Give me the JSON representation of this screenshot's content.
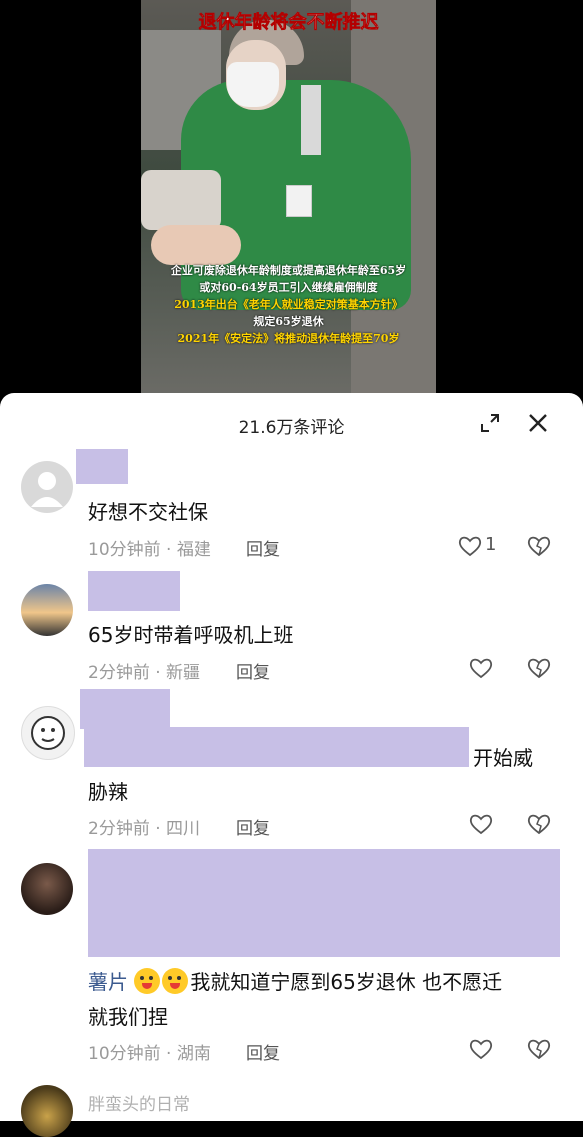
{
  "video": {
    "headline_top": "推迟...",
    "headline": "退休年龄将会不断推迟",
    "captions": [
      "企业可废除退休年龄制度或提高退休年龄至65岁",
      "或对60-64岁员工引入继续雇佣制度",
      "2013年出台《老年人就业稳定对策基本方针》",
      "规定65岁退休",
      "2021年《安定法》将推动退休年龄提至70岁"
    ]
  },
  "header": {
    "title": "21.6万条评论"
  },
  "comments": [
    {
      "text": "好想不交社保",
      "time": "10分钟前",
      "location": "福建",
      "reply": "回复",
      "likes": "1"
    },
    {
      "text": "65岁时带着呼吸机上班",
      "time": "2分钟前",
      "location": "新疆",
      "reply": "回复"
    },
    {
      "text_line1_tail": "开始威",
      "text_line2": "胁辣",
      "time": "2分钟前",
      "location": "四川",
      "reply": "回复"
    },
    {
      "mention": "薯片",
      "text_line1": "我就知道宁愿到65岁退休 也不愿迁",
      "text_line2": "就我们捏",
      "time": "10分钟前",
      "location": "湖南",
      "reply": "回复"
    }
  ],
  "next_comment": {
    "username": "胖蛮头的日常"
  },
  "colors": {
    "redaction": "#c7bfe6",
    "mention": "#3b5a8f"
  }
}
